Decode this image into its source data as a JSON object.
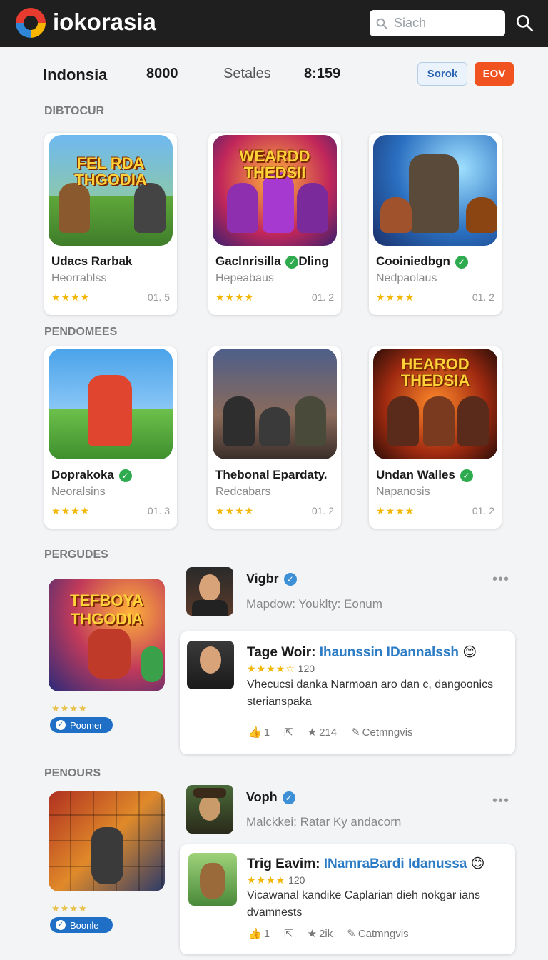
{
  "header": {
    "brand": "iokorasia",
    "search_placeholder": "Siach"
  },
  "filters": {
    "country": "Indonsia",
    "f2": "8000",
    "f3": "Setales",
    "f4": "8:159",
    "btn_secondary": "Sorok",
    "btn_primary": "EOV"
  },
  "sections": {
    "s1": "DIBTOCUR",
    "s2": "PENDOMEES",
    "s3": "PERGUDES",
    "s4": "PENOURS"
  },
  "cards": [
    {
      "title": "Udacs Rarbak",
      "verified": false,
      "sub": "Heorrablss",
      "stars": "★★★★",
      "rating": "01. 5",
      "art_text": "FEL RDA THGODIA"
    },
    {
      "title": "Gaclnrisilla",
      "title2": "Dling",
      "verified": true,
      "sub": "Hepeabaus",
      "stars": "★★★★",
      "rating": "01. 2",
      "art_text": "WEARDD THEDSII"
    },
    {
      "title": "Cooiniedbgn",
      "verified": true,
      "sub": "Nedpaolaus",
      "stars": "★★★★",
      "rating": "01. 2",
      "art_text": ""
    },
    {
      "title": "Doprakoka",
      "verified": true,
      "sub": "Neoralsins",
      "stars": "★★★★",
      "rating": "01. 3",
      "art_text": ""
    },
    {
      "title": "Thebonal Epardaty.",
      "verified": false,
      "sub": "Redcabars",
      "stars": "★★★★",
      "rating": "01. 2",
      "art_text": ""
    },
    {
      "title": "Undan Walles",
      "verified": true,
      "sub": "Napanosis",
      "stars": "★★★★",
      "rating": "01. 2",
      "art_text": "HEAROD THEDSIA"
    }
  ],
  "promos": [
    {
      "art_text": "TEFBOYA THGODIA",
      "stars": "★★★★",
      "pill": "Poomer"
    },
    {
      "art_text": "",
      "stars": "★★★★",
      "pill": "Boonle"
    }
  ],
  "feed": [
    {
      "user": "Vigbr",
      "meta": "Mapdow: Youklty: Eonum",
      "post": {
        "title_a": "Tage Woir: ",
        "title_b": "Ihaunssin IDannalssh",
        "emoji": "😊",
        "stars": "★★★★☆",
        "count": "120",
        "body": "Vhecucsi danka Narmoan aro dan c, dangoonics sterianspaka",
        "likes": "1",
        "shares": "",
        "rating": "214",
        "action": "Cetmngvis"
      }
    },
    {
      "user": "Voph",
      "meta": "Malckkei; Ratar Ky andacorn",
      "post": {
        "title_a": "Trig Eavim: ",
        "title_b": "INamraBardi Idanussa",
        "emoji": "😊",
        "stars": "★★★★",
        "count": "120",
        "body": "Vicawanal kandike Caplarian dieh nokgar ians dvamnests",
        "likes": "1",
        "shares": "",
        "rating": "2ik",
        "action": "Catmngvis"
      }
    }
  ]
}
